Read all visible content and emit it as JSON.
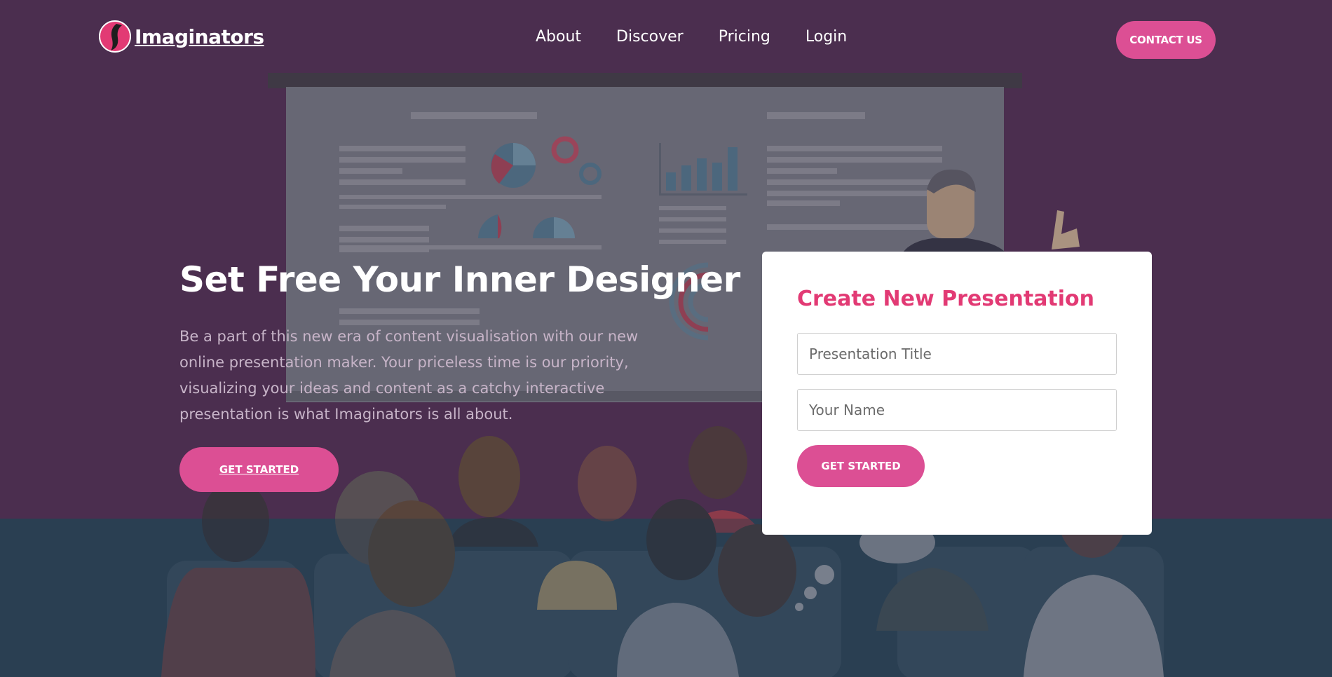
{
  "brand": {
    "name": "Imaginators",
    "accent_color": "#dc4f94",
    "background_color": "#4b2e4f"
  },
  "nav": {
    "items": [
      {
        "label": "About"
      },
      {
        "label": "Discover"
      },
      {
        "label": "Pricing"
      },
      {
        "label": "Login"
      }
    ]
  },
  "header": {
    "contact_label": "CONTACT US"
  },
  "hero": {
    "title": "Set Free Your Inner Designer",
    "description": "Be a part of this new era of content visualisation with our new online presentation maker. Your priceless time is our priority, visualizing your ideas and content as a catchy interactive presentation is what Imaginators is all about.",
    "cta_label": "GET STARTED"
  },
  "form": {
    "title": "Create New Presentation",
    "title_color": "#e23a74",
    "presentation_title_placeholder": "Presentation Title",
    "name_placeholder": "Your Name",
    "submit_label": "GET STARTED"
  }
}
